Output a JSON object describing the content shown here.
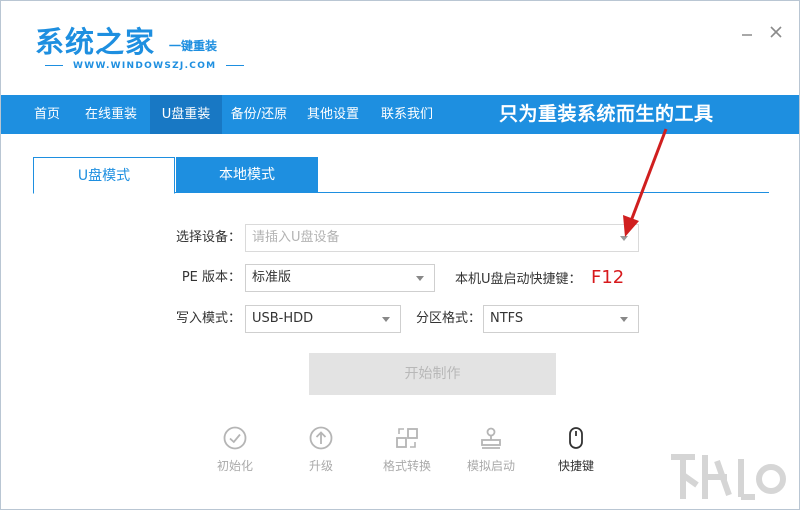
{
  "header": {
    "title": "系统之家",
    "subtitle": "一键重装",
    "url": "WWW.WINDOWSZJ.COM",
    "minimize_icon": "minimize-icon",
    "close_icon": "close-icon"
  },
  "nav": {
    "items": [
      {
        "label": "首页"
      },
      {
        "label": "在线重装"
      },
      {
        "label": "U盘重装"
      },
      {
        "label": "备份/还原"
      },
      {
        "label": "其他设置"
      },
      {
        "label": "联系我们"
      }
    ],
    "active": "U盘重装",
    "slogan": "只为重装系统而生的工具"
  },
  "tabs": {
    "items": [
      {
        "label": "U盘模式"
      },
      {
        "label": "本地模式"
      }
    ],
    "active": "U盘模式"
  },
  "form": {
    "device": {
      "label": "选择设备：",
      "placeholder": "请插入U盘设备"
    },
    "pe_version": {
      "label": "PE 版本：",
      "value": "标准版"
    },
    "hotkey": {
      "label": "本机U盘启动快捷键：",
      "value": "F12"
    },
    "write_mode": {
      "label": "写入模式：",
      "value": "USB-HDD"
    },
    "partition": {
      "label": "分区格式：",
      "value": "NTFS"
    },
    "start_label": "开始制作"
  },
  "tools": [
    {
      "label": "初始化",
      "icon": "check-circle-icon"
    },
    {
      "label": "升级",
      "icon": "upload-arrow-icon"
    },
    {
      "label": "格式转换",
      "icon": "convert-icon"
    },
    {
      "label": "模拟启动",
      "icon": "stamp-icon"
    },
    {
      "label": "快捷键",
      "icon": "mouse-icon"
    }
  ],
  "colors": {
    "accent": "#1e8fe0",
    "nav_active": "#1878c4",
    "hotkey": "#d7191c",
    "arrow": "#d01f1f"
  }
}
